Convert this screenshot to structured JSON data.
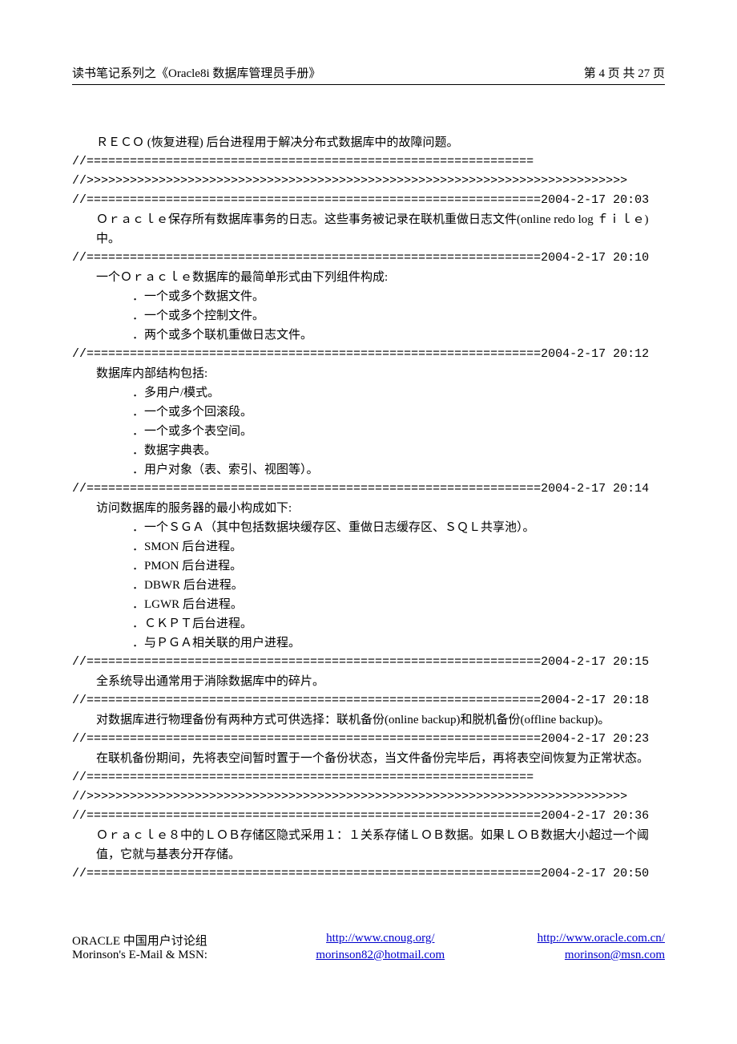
{
  "header": {
    "left": "读书笔记系列之《Oracle8i 数据库管理员手册》",
    "right": "第 4 页  共 27 页"
  },
  "body": {
    "p1": "ＲＥＣＯ (恢复进程) 后台进程用于解决分布式数据库中的故障问题。",
    "sep1": "//==============================================================",
    "sep2": "//>>>>>>>>>>>>>>>>>>>>>>>>>>>>>>>>>>>>>>>>>>>>>>>>>>>>>>>>>>>>>>>>>>>>>>>>>>>",
    "sep3": "//===============================================================2004-2-17 20:03",
    "p2": "Ｏｒａｃｌｅ保存所有数据库事务的日志。这些事务被记录在联机重做日志文件(online redo log ｆｉｌｅ)中。",
    "sep4": "//===============================================================2004-2-17 20:10",
    "p3": "一个Ｏｒａｃｌｅ数据库的最简单形式由下列组件构成:",
    "li1": "．一个或多个数据文件。",
    "li2": "．一个或多个控制文件。",
    "li3": "．两个或多个联机重做日志文件。",
    "sep5": "//===============================================================2004-2-17 20:12",
    "p4": "数据库内部结构包括:",
    "li4": "．多用户/模式。",
    "li5": "．一个或多个回滚段。",
    "li6": "．一个或多个表空间。",
    "li7": "．数据字典表。",
    "li8": "．用户对象（表、索引、视图等）。",
    "sep6": "//===============================================================2004-2-17 20:14",
    "p5": "访问数据库的服务器的最小构成如下:",
    "li9": "．一个ＳＧＡ（其中包括数据块缓存区、重做日志缓存区、ＳＱＬ共享池）。",
    "li10": "．SMON 后台进程。",
    "li11": "．PMON 后台进程。",
    "li12": "．DBWR 后台进程。",
    "li13": "．LGWR 后台进程。",
    "li14": "．ＣＫＰＴ后台进程。",
    "li15": "．与ＰＧＡ相关联的用户进程。",
    "sep7": "//===============================================================2004-2-17 20:15",
    "p6": "全系统导出通常用于消除数据库中的碎片。",
    "sep8": "//===============================================================2004-2-17 20:18",
    "p7": "对数据库进行物理备份有两种方式可供选择：联机备份(online backup)和脱机备份(offline backup)。",
    "sep9": "//===============================================================2004-2-17 20:23",
    "p8": "在联机备份期间，先将表空间暂时置于一个备份状态，当文件备份完毕后，再将表空间恢复为正常状态。",
    "sep10": "//==============================================================",
    "sep11": "//>>>>>>>>>>>>>>>>>>>>>>>>>>>>>>>>>>>>>>>>>>>>>>>>>>>>>>>>>>>>>>>>>>>>>>>>>>>",
    "sep12": "//===============================================================2004-2-17 20:36",
    "p9": "Ｏｒａｃｌｅ８中的ＬＯＢ存储区隐式采用１：１关系存储ＬＯＢ数据。如果ＬＯＢ数据大小超过一个阈值，它就与基表分开存储。",
    "sep13": "//===============================================================2004-2-17 20:50"
  },
  "footer": {
    "row1_left": "ORACLE 中国用户讨论组",
    "row1_mid": "http://www.cnoug.org/",
    "row1_right": "http://www.oracle.com.cn/",
    "row2_left": "Morinson's E-Mail & MSN:",
    "row2_mid": "morinson82@hotmail.com",
    "row2_right": "morinson@msn.com"
  }
}
